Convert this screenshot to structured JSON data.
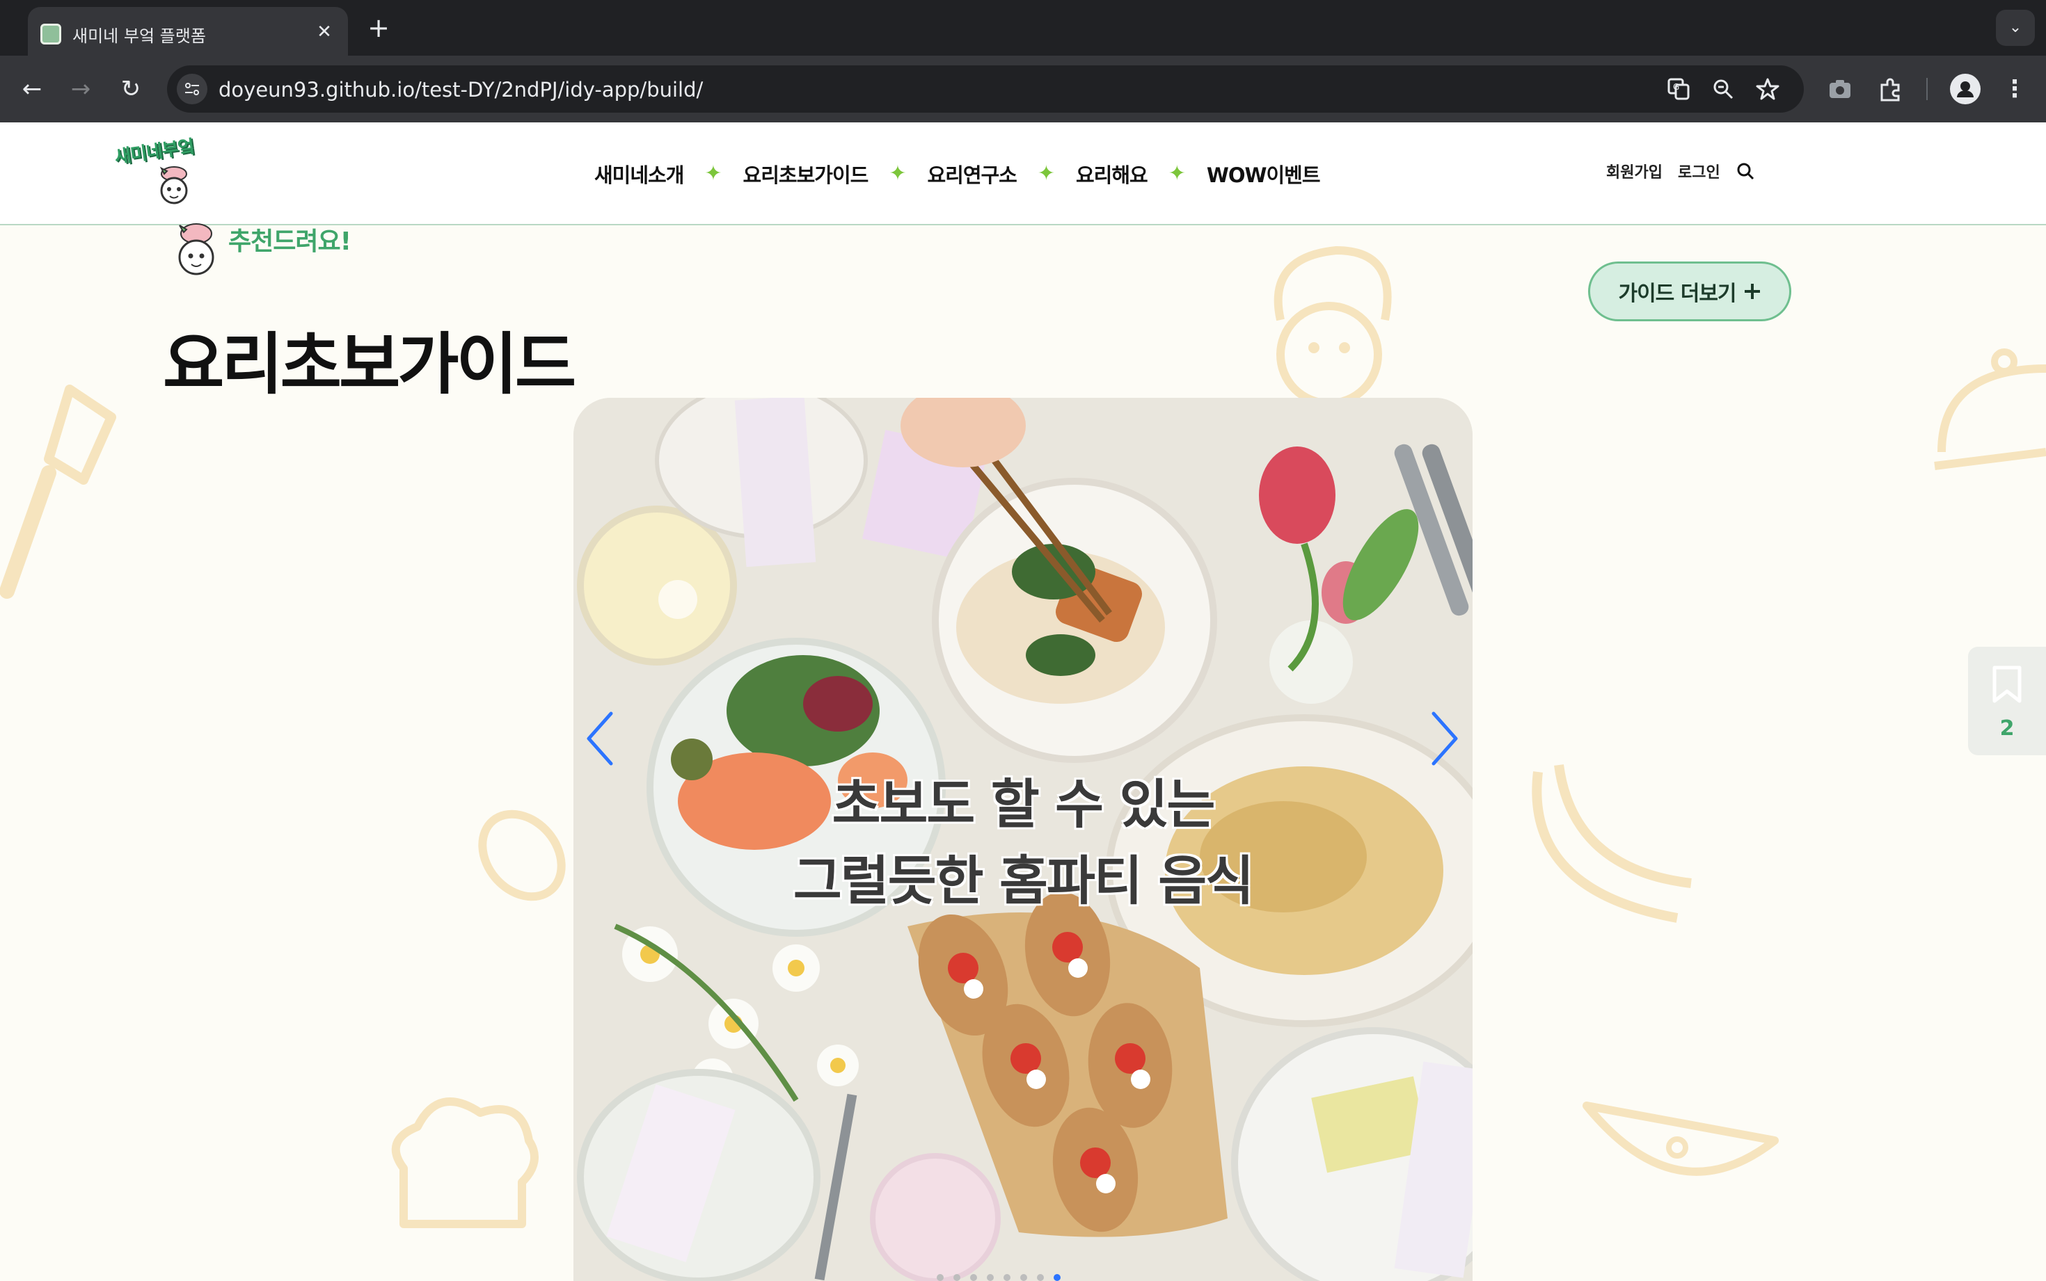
{
  "browser": {
    "tab_title": "새미네 부엌 플랫폼",
    "url": "doyeun93.github.io/test-DY/2ndPJ/idy-app/build/"
  },
  "header": {
    "logo_text": "새미네부엌",
    "nav": [
      "새미네소개",
      "요리초보가이드",
      "요리연구소",
      "요리해요",
      "WOW이벤트"
    ],
    "signup": "회원가입",
    "login": "로그인"
  },
  "main": {
    "badge_label": "추천드려요!",
    "section_title": "요리초보가이드",
    "more_button": "가이드 더보기",
    "slider": {
      "caption_line1": "초보도 할 수 있는",
      "caption_line2": "그럴듯한 홈파티 음식",
      "dot_count": 8,
      "active_dot": 7
    }
  },
  "quick_widget": {
    "count": "2"
  },
  "colors": {
    "brand_green": "#3fa56a",
    "nav_star": "#7cc63b",
    "slider_arrow": "#2c74ff",
    "page_bg": "#fdfcf6"
  }
}
